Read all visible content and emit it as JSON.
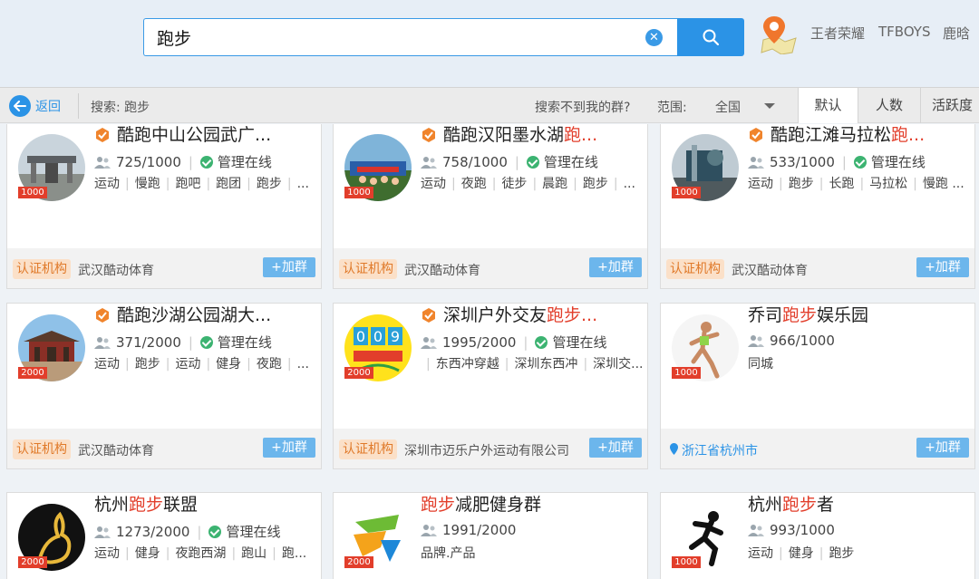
{
  "search": {
    "value": "跑步"
  },
  "hotwords": [
    "王者荣耀",
    "TFBOYS",
    "鹿晗"
  ],
  "subbar": {
    "back": "返回",
    "search_label": "搜索: 跑步",
    "not_found": "搜索不到我的群?",
    "range_label": "范围:",
    "range_value": "全国",
    "sort_tabs": [
      "默认",
      "人数",
      "活跃度"
    ]
  },
  "colors": {
    "accent": "#2b93e6",
    "highlight": "#e23e2b",
    "cert": "#e07a2a"
  },
  "cards": [
    {
      "name_pre": "酷跑中山公园武广...",
      "name_hl": "",
      "name_post": "",
      "vip": true,
      "badge": "1000",
      "members": "725/1000",
      "manager": "管理在线",
      "tags": [
        "运动",
        "慢跑",
        "跑吧",
        "跑团",
        "跑步",
        "..."
      ],
      "cert": "认证机构",
      "org": "武汉酷动体育",
      "join": "+加群",
      "avatar": "gate"
    },
    {
      "name_pre": "酷跑汉阳墨水湖",
      "name_hl": "跑...",
      "name_post": "",
      "vip": true,
      "badge": "1000",
      "members": "758/1000",
      "manager": "管理在线",
      "tags": [
        "运动",
        "夜跑",
        "徒步",
        "晨跑",
        "跑步",
        "..."
      ],
      "cert": "认证机构",
      "org": "武汉酷动体育",
      "join": "+加群",
      "avatar": "crowd"
    },
    {
      "name_pre": "酷跑江滩马拉松",
      "name_hl": "跑...",
      "name_post": "",
      "vip": true,
      "badge": "1000",
      "members": "533/1000",
      "manager": "管理在线",
      "tags": [
        "运动",
        "跑步",
        "长跑",
        "马拉松",
        "慢跑 ..."
      ],
      "cert": "认证机构",
      "org": "武汉酷动体育",
      "join": "+加群",
      "avatar": "building"
    },
    {
      "name_pre": "酷跑沙湖公园湖大...",
      "name_hl": "",
      "name_post": "",
      "vip": true,
      "badge": "2000",
      "members": "371/2000",
      "manager": "管理在线",
      "tags": [
        "运动",
        "跑步",
        "运动",
        "健身",
        "夜跑",
        "..."
      ],
      "cert": "认证机构",
      "org": "武汉酷动体育",
      "join": "+加群",
      "avatar": "pavilion"
    },
    {
      "name_pre": "深圳户外交友",
      "name_hl": "跑步...",
      "name_post": "",
      "vip": true,
      "badge": "2000",
      "members": "1995/2000",
      "manager": "管理在线",
      "tags": [
        "",
        "东西冲穿越",
        "深圳东西冲",
        "深圳交..."
      ],
      "cert": "认证机构",
      "org": "深圳市迈乐户外运动有限公司",
      "join": "+加群",
      "avatar": "sign"
    },
    {
      "name_pre": "乔司",
      "name_hl": "跑步",
      "name_post": "娱乐园",
      "vip": false,
      "badge": "1000",
      "members": "966/1000",
      "manager": "",
      "tags": [
        "同城"
      ],
      "cert": "",
      "org": "",
      "location": "浙江省杭州市",
      "join": "+加群",
      "avatar": "runner"
    },
    {
      "name_pre": "杭州",
      "name_hl": "跑步",
      "name_post": "联盟",
      "vip": false,
      "badge": "2000",
      "members": "1273/2000",
      "manager": "管理在线",
      "tags": [
        "运动",
        "健身",
        "夜跑西湖",
        "跑山",
        "跑..."
      ],
      "cert": "",
      "org": "",
      "join": "",
      "avatar": "rabbit"
    },
    {
      "name_pre": "",
      "name_hl": "跑步",
      "name_post": "减肥健身群",
      "vip": false,
      "badge": "2000",
      "members": "1991/2000",
      "manager": "",
      "tags": [
        "品牌.产品"
      ],
      "cert": "",
      "org": "",
      "join": "",
      "avatar": "logo"
    },
    {
      "name_pre": "杭州",
      "name_hl": "跑步",
      "name_post": "者",
      "vip": false,
      "badge": "1000",
      "members": "993/1000",
      "manager": "",
      "tags": [
        "运动",
        "健身",
        "跑步"
      ],
      "cert": "",
      "org": "",
      "join": "",
      "avatar": "silhouette"
    }
  ]
}
